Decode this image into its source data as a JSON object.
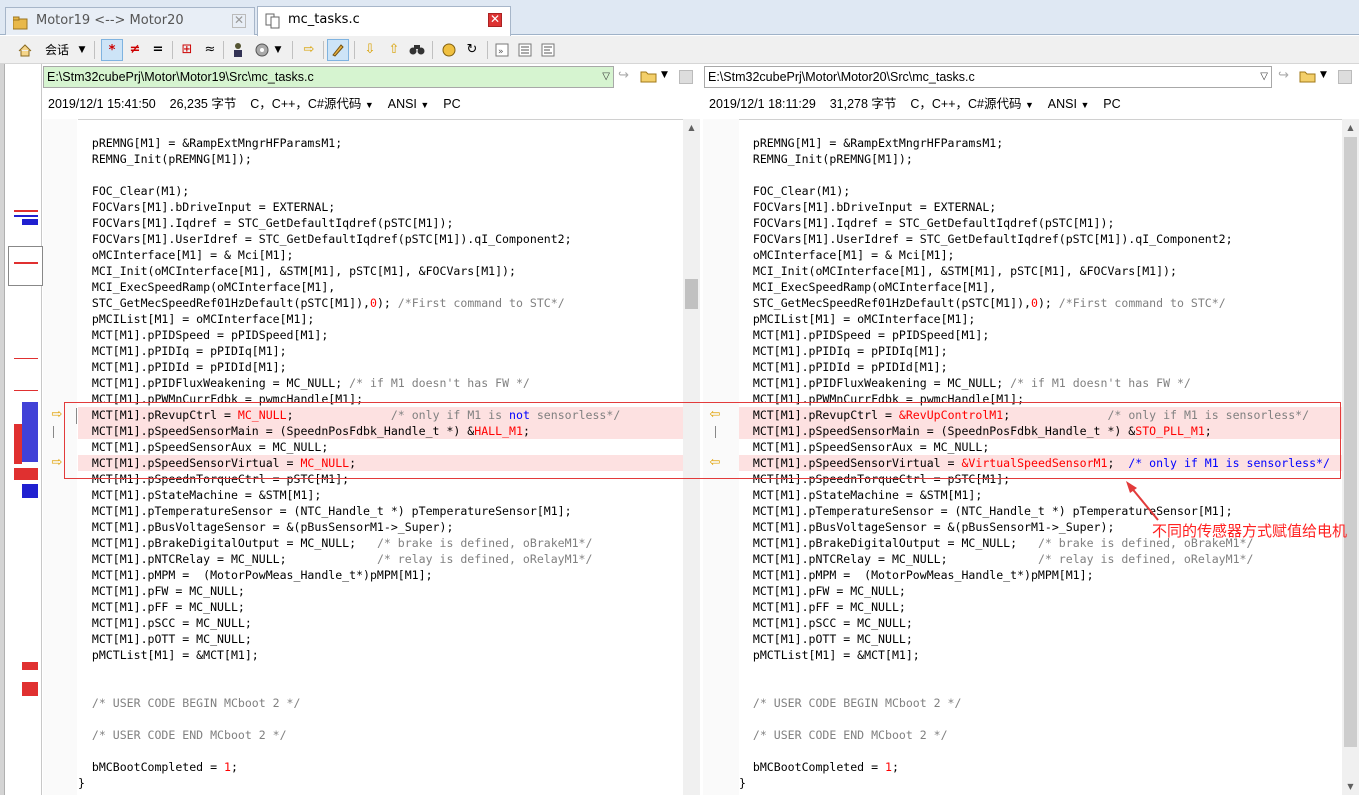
{
  "tabs": [
    {
      "label": "Motor19 <--> Motor20",
      "active": false,
      "icon": "folder-compare-icon"
    },
    {
      "label": "mc_tasks.c",
      "active": true,
      "icon": "file-compare-icon"
    }
  ],
  "toolbar": {
    "session_label": "会话"
  },
  "left": {
    "path": "E:\\Stm32cubePrj\\Motor\\Motor19\\Src\\mc_tasks.c",
    "date": "2019/12/1 15:41:50",
    "size": "26,235 字节",
    "lang": "C，C++，C#源代码",
    "encoding": "ANSI",
    "lineend": "PC"
  },
  "right": {
    "path": "E:\\Stm32cubePrj\\Motor\\Motor20\\Src\\mc_tasks.c",
    "date": "2019/12/1 18:11:29",
    "size": "31,278 字节",
    "lang": "C，C++，C#源代码",
    "encoding": "ANSI",
    "lineend": "PC"
  },
  "left_code": [
    "",
    "  pREMNG[M1] = &RampExtMngrHFParamsM1;",
    "  REMNG_Init(pREMNG[M1]);",
    "",
    "  FOC_Clear(M1);",
    "  FOCVars[M1].bDriveInput = EXTERNAL;",
    "  FOCVars[M1].Iqdref = STC_GetDefaultIqdref(pSTC[M1]);",
    "  FOCVars[M1].UserIdref = STC_GetDefaultIqdref(pSTC[M1]).qI_Component2;",
    "  oMCInterface[M1] = & Mci[M1];",
    "  MCI_Init(oMCInterface[M1], &STM[M1], pSTC[M1], &FOCVars[M1]);",
    "  MCI_ExecSpeedRamp(oMCInterface[M1],",
    "  STC_GetMecSpeedRef01HzDefault(pSTC[M1]),0); /*First command to STC*/",
    "  pMCIList[M1] = oMCInterface[M1];",
    "  MCT[M1].pPIDSpeed = pPIDSpeed[M1];",
    "  MCT[M1].pPIDIq = pPIDIq[M1];",
    "  MCT[M1].pPIDId = pPIDId[M1];",
    "  MCT[M1].pPIDFluxWeakening = MC_NULL; /* if M1 doesn't has FW */",
    "  MCT[M1].pPWMnCurrFdbk = pwmcHandle[M1];",
    "  MCT[M1].pRevupCtrl = MC_NULL;              /* only if M1 is not sensorless*/",
    "  MCT[M1].pSpeedSensorMain = (SpeednPosFdbk_Handle_t *) &HALL_M1;",
    "  MCT[M1].pSpeedSensorAux = MC_NULL;",
    "  MCT[M1].pSpeedSensorVirtual = MC_NULL;",
    "  MCT[M1].pSpeednTorqueCtrl = pSTC[M1];",
    "  MCT[M1].pStateMachine = &STM[M1];",
    "  MCT[M1].pTemperatureSensor = (NTC_Handle_t *) pTemperatureSensor[M1];",
    "  MCT[M1].pBusVoltageSensor = &(pBusSensorM1->_Super);",
    "  MCT[M1].pBrakeDigitalOutput = MC_NULL;   /* brake is defined, oBrakeM1*/",
    "  MCT[M1].pNTCRelay = MC_NULL;             /* relay is defined, oRelayM1*/",
    "  MCT[M1].pMPM =  (MotorPowMeas_Handle_t*)pMPM[M1];",
    "  MCT[M1].pFW = MC_NULL;",
    "  MCT[M1].pFF = MC_NULL;",
    "  MCT[M1].pSCC = MC_NULL;",
    "  MCT[M1].pOTT = MC_NULL;",
    "  pMCTList[M1] = &MCT[M1];",
    "",
    "",
    "  /* USER CODE BEGIN MCboot 2 */",
    "",
    "  /* USER CODE END MCboot 2 */",
    "",
    "  bMCBootCompleted = 1;",
    "}"
  ],
  "right_code": [
    "",
    "  pREMNG[M1] = &RampExtMngrHFParamsM1;",
    "  REMNG_Init(pREMNG[M1]);",
    "",
    "  FOC_Clear(M1);",
    "  FOCVars[M1].bDriveInput = EXTERNAL;",
    "  FOCVars[M1].Iqdref = STC_GetDefaultIqdref(pSTC[M1]);",
    "  FOCVars[M1].UserIdref = STC_GetDefaultIqdref(pSTC[M1]).qI_Component2;",
    "  oMCInterface[M1] = & Mci[M1];",
    "  MCI_Init(oMCInterface[M1], &STM[M1], pSTC[M1], &FOCVars[M1]);",
    "  MCI_ExecSpeedRamp(oMCInterface[M1],",
    "  STC_GetMecSpeedRef01HzDefault(pSTC[M1]),0); /*First command to STC*/",
    "  pMCIList[M1] = oMCInterface[M1];",
    "  MCT[M1].pPIDSpeed = pPIDSpeed[M1];",
    "  MCT[M1].pPIDIq = pPIDIq[M1];",
    "  MCT[M1].pPIDId = pPIDId[M1];",
    "  MCT[M1].pPIDFluxWeakening = MC_NULL; /* if M1 doesn't has FW */",
    "  MCT[M1].pPWMnCurrFdbk = pwmcHandle[M1];",
    "  MCT[M1].pRevupCtrl = &RevUpControlM1;              /* only if M1 is sensorless*/",
    "  MCT[M1].pSpeedSensorMain = (SpeednPosFdbk_Handle_t *) &STO_PLL_M1;",
    "  MCT[M1].pSpeedSensorAux = MC_NULL;",
    "  MCT[M1].pSpeedSensorVirtual = &VirtualSpeedSensorM1;  /* only if M1 is sensorless*/",
    "  MCT[M1].pSpeednTorqueCtrl = pSTC[M1];",
    "  MCT[M1].pStateMachine = &STM[M1];",
    "  MCT[M1].pTemperatureSensor = (NTC_Handle_t *) pTemperatureSensor[M1];",
    "  MCT[M1].pBusVoltageSensor = &(pBusSensorM1->_Super);",
    "  MCT[M1].pBrakeDigitalOutput = MC_NULL;   /* brake is defined, oBrakeM1*/",
    "  MCT[M1].pNTCRelay = MC_NULL;             /* relay is defined, oRelayM1*/",
    "  MCT[M1].pMPM =  (MotorPowMeas_Handle_t*)pMPM[M1];",
    "  MCT[M1].pFW = MC_NULL;",
    "  MCT[M1].pFF = MC_NULL;",
    "  MCT[M1].pSCC = MC_NULL;",
    "  MCT[M1].pOTT = MC_NULL;",
    "  pMCTList[M1] = &MCT[M1];",
    "",
    "",
    "  /* USER CODE BEGIN MCboot 2 */",
    "",
    "  /* USER CODE END MCboot 2 */",
    "",
    "  bMCBootCompleted = 1;",
    "}"
  ],
  "diff_rows": [
    18,
    19,
    21
  ],
  "annotation": {
    "text": "不同的传感器方式赋值给电机",
    "color": "#ff2020"
  }
}
